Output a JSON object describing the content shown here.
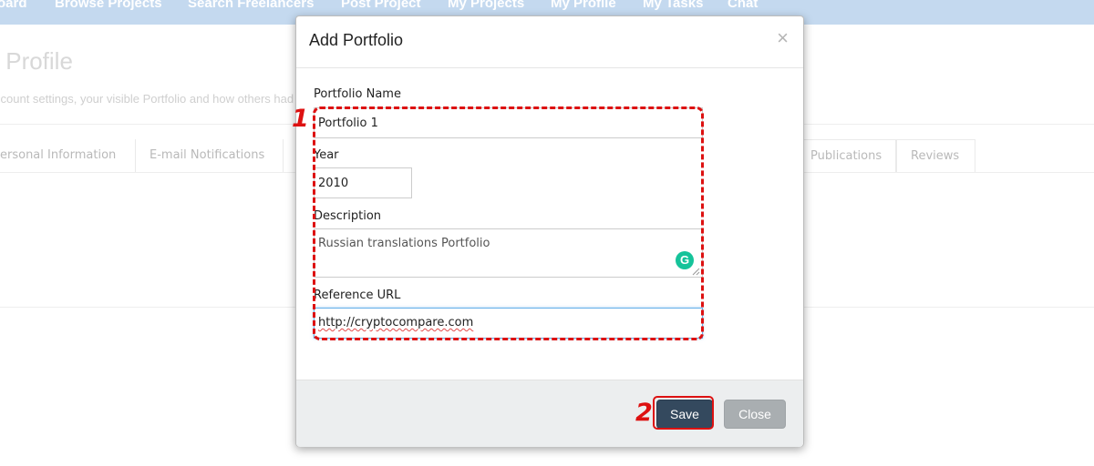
{
  "topnav": {
    "items": [
      {
        "label": "oard"
      },
      {
        "label": "Browse Projects"
      },
      {
        "label": "Search Freelancers"
      },
      {
        "label": "Post Project"
      },
      {
        "label": "My Projects"
      },
      {
        "label": "My Profile"
      },
      {
        "label": "My Tasks"
      },
      {
        "label": "Chat"
      }
    ]
  },
  "page": {
    "heading": "y Profile",
    "subtext": "ccount settings, your visible Portfolio and how others had",
    "tabs": [
      {
        "label": "ersonal Information"
      },
      {
        "label": "E-mail Notifications"
      },
      {
        "label": "Publications"
      },
      {
        "label": "Reviews"
      }
    ]
  },
  "modal": {
    "title": "Add Portfolio",
    "close_symbol": "×",
    "fields": {
      "portfolio_name": {
        "label": "Portfolio Name",
        "value": "Portfolio 1"
      },
      "year": {
        "label": "Year",
        "value": "2010"
      },
      "description": {
        "label": "Description",
        "value": "Russian translations Portfolio"
      },
      "reference_url": {
        "label": "Reference URL",
        "value": "http://cryptocompare.com"
      }
    },
    "grammarly_symbol": "G",
    "buttons": {
      "save": "Save",
      "close": "Close"
    }
  },
  "annotations": {
    "fields_marker": "1",
    "save_marker": "2"
  },
  "colors": {
    "nav_bar": "#c4d9ef",
    "save_button": "#34495e",
    "close_button": "#a9aeb1",
    "annotation": "#dd1111",
    "grammarly": "#15c39a"
  }
}
